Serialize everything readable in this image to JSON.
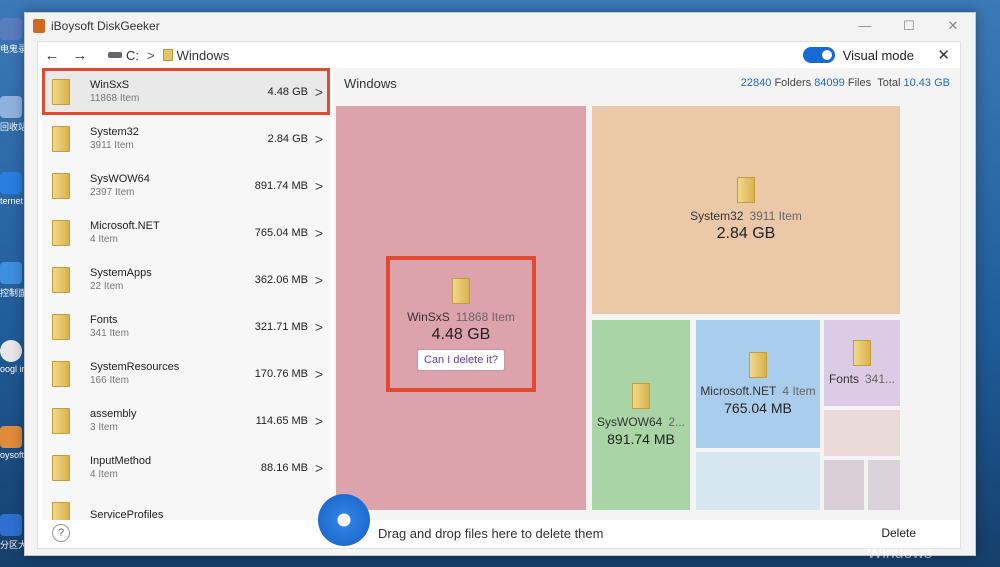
{
  "app": {
    "title": "iBoysoft DiskGeeker",
    "win_minimize": "—",
    "win_maximize": "☐",
    "win_close": "✕"
  },
  "desktop": {
    "icons": [
      {
        "label": "电鬼录",
        "color": "#5a7dc0"
      },
      {
        "label": "回收站",
        "color": "#8fb2dd"
      },
      {
        "label": "ternet plore",
        "color": "#2a7de0"
      },
      {
        "label": "控制面板",
        "color": "#3f8fe0"
      },
      {
        "label": "oogl irom",
        "color": "#e8e8e8"
      },
      {
        "label": "oysoft",
        "color": "#e08a3a"
      },
      {
        "label": "分区大",
        "color": "#2f6fd0"
      }
    ],
    "watermark": "Windows"
  },
  "nav": {
    "back": "←",
    "forward": "→",
    "drive": "C:",
    "sep": ">",
    "folder": "Windows"
  },
  "visual_mode": {
    "label": "Visual mode",
    "enabled": true
  },
  "panel_close": "✕",
  "list": [
    {
      "name": "WinSxS",
      "count": "11868 Item",
      "size": "4.48 GB",
      "selected": true
    },
    {
      "name": "System32",
      "count": "3911 Item",
      "size": "2.84 GB"
    },
    {
      "name": "SysWOW64",
      "count": "2397 Item",
      "size": "891.74 MB"
    },
    {
      "name": "Microsoft.NET",
      "count": "4 Item",
      "size": "765.04 MB"
    },
    {
      "name": "SystemApps",
      "count": "22 Item",
      "size": "362.06 MB"
    },
    {
      "name": "Fonts",
      "count": "341 Item",
      "size": "321.71 MB"
    },
    {
      "name": "SystemResources",
      "count": "166 Item",
      "size": "170.76 MB"
    },
    {
      "name": "assembly",
      "count": "3 Item",
      "size": "114.65 MB"
    },
    {
      "name": "InputMethod",
      "count": "4 Item",
      "size": "88.16 MB"
    },
    {
      "name": "ServiceProfiles",
      "count": "",
      "size": ""
    }
  ],
  "chevron": ">",
  "right": {
    "title": "Windows",
    "folders_count": "22840",
    "folders_label": "Folders",
    "files_count": "84099",
    "files_label": "Files",
    "total_label": "Total",
    "total_value": "10.43 GB"
  },
  "treemap": {
    "winsxs": {
      "name": "WinSxS",
      "count": "11868 Item",
      "size": "4.48 GB",
      "button": "Can I delete it?",
      "color": "#dca3ad"
    },
    "system32": {
      "name": "System32",
      "count": "3911 Item",
      "size": "2.84 GB",
      "color": "#eac8a8"
    },
    "syswow64": {
      "name": "SysWOW64",
      "count": "2...",
      "size": "891.74 MB",
      "color": "#a8d4a6"
    },
    "dotnet": {
      "name": "Microsoft.NET",
      "count": "4 Item",
      "size": "765.04 MB",
      "color": "#a9cdec"
    },
    "fonts": {
      "name": "Fonts",
      "count": "341...",
      "color": "#dccbe4"
    }
  },
  "bottom": {
    "help": "?",
    "drop_text": "Drag and drop files here to delete them",
    "delete": "Delete"
  }
}
